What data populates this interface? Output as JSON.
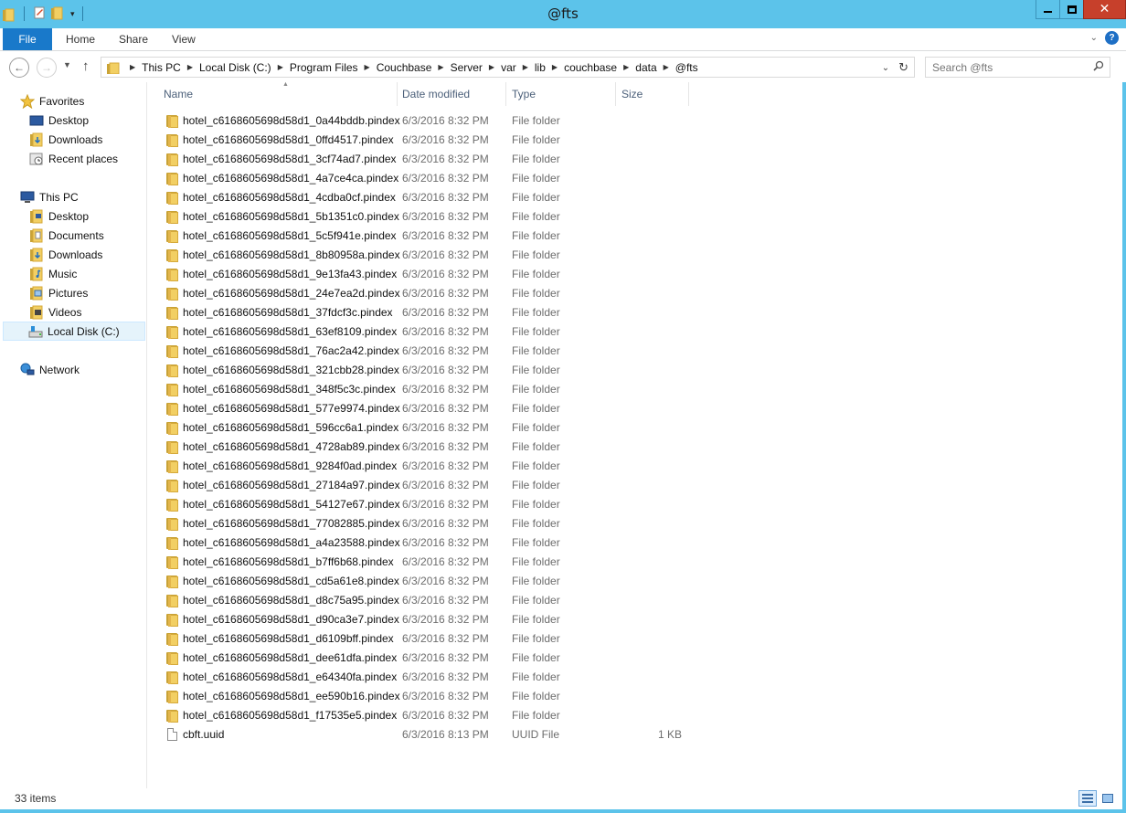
{
  "window": {
    "title": "@fts"
  },
  "ribbon": {
    "tabs": [
      "File",
      "Home",
      "Share",
      "View"
    ]
  },
  "address": {
    "crumbs": [
      "This PC",
      "Local Disk (C:)",
      "Program Files",
      "Couchbase",
      "Server",
      "var",
      "lib",
      "couchbase",
      "data",
      "@fts"
    ]
  },
  "search": {
    "placeholder": "Search @fts"
  },
  "navpane": {
    "favorites_label": "Favorites",
    "favorites": [
      "Desktop",
      "Downloads",
      "Recent places"
    ],
    "thispc_label": "This PC",
    "thispc": [
      "Desktop",
      "Documents",
      "Downloads",
      "Music",
      "Pictures",
      "Videos",
      "Local Disk (C:)"
    ],
    "network_label": "Network"
  },
  "columns": {
    "name": "Name",
    "date": "Date modified",
    "type": "Type",
    "size": "Size"
  },
  "files": [
    {
      "name": "hotel_c6168605698d58d1_0a44bddb.pindex",
      "date": "6/3/2016 8:32 PM",
      "type": "File folder",
      "size": "",
      "kind": "folder"
    },
    {
      "name": "hotel_c6168605698d58d1_0ffd4517.pindex",
      "date": "6/3/2016 8:32 PM",
      "type": "File folder",
      "size": "",
      "kind": "folder"
    },
    {
      "name": "hotel_c6168605698d58d1_3cf74ad7.pindex",
      "date": "6/3/2016 8:32 PM",
      "type": "File folder",
      "size": "",
      "kind": "folder"
    },
    {
      "name": "hotel_c6168605698d58d1_4a7ce4ca.pindex",
      "date": "6/3/2016 8:32 PM",
      "type": "File folder",
      "size": "",
      "kind": "folder"
    },
    {
      "name": "hotel_c6168605698d58d1_4cdba0cf.pindex",
      "date": "6/3/2016 8:32 PM",
      "type": "File folder",
      "size": "",
      "kind": "folder"
    },
    {
      "name": "hotel_c6168605698d58d1_5b1351c0.pindex",
      "date": "6/3/2016 8:32 PM",
      "type": "File folder",
      "size": "",
      "kind": "folder"
    },
    {
      "name": "hotel_c6168605698d58d1_5c5f941e.pindex",
      "date": "6/3/2016 8:32 PM",
      "type": "File folder",
      "size": "",
      "kind": "folder"
    },
    {
      "name": "hotel_c6168605698d58d1_8b80958a.pindex",
      "date": "6/3/2016 8:32 PM",
      "type": "File folder",
      "size": "",
      "kind": "folder"
    },
    {
      "name": "hotel_c6168605698d58d1_9e13fa43.pindex",
      "date": "6/3/2016 8:32 PM",
      "type": "File folder",
      "size": "",
      "kind": "folder"
    },
    {
      "name": "hotel_c6168605698d58d1_24e7ea2d.pindex",
      "date": "6/3/2016 8:32 PM",
      "type": "File folder",
      "size": "",
      "kind": "folder"
    },
    {
      "name": "hotel_c6168605698d58d1_37fdcf3c.pindex",
      "date": "6/3/2016 8:32 PM",
      "type": "File folder",
      "size": "",
      "kind": "folder"
    },
    {
      "name": "hotel_c6168605698d58d1_63ef8109.pindex",
      "date": "6/3/2016 8:32 PM",
      "type": "File folder",
      "size": "",
      "kind": "folder"
    },
    {
      "name": "hotel_c6168605698d58d1_76ac2a42.pindex",
      "date": "6/3/2016 8:32 PM",
      "type": "File folder",
      "size": "",
      "kind": "folder"
    },
    {
      "name": "hotel_c6168605698d58d1_321cbb28.pindex",
      "date": "6/3/2016 8:32 PM",
      "type": "File folder",
      "size": "",
      "kind": "folder"
    },
    {
      "name": "hotel_c6168605698d58d1_348f5c3c.pindex",
      "date": "6/3/2016 8:32 PM",
      "type": "File folder",
      "size": "",
      "kind": "folder"
    },
    {
      "name": "hotel_c6168605698d58d1_577e9974.pindex",
      "date": "6/3/2016 8:32 PM",
      "type": "File folder",
      "size": "",
      "kind": "folder"
    },
    {
      "name": "hotel_c6168605698d58d1_596cc6a1.pindex",
      "date": "6/3/2016 8:32 PM",
      "type": "File folder",
      "size": "",
      "kind": "folder"
    },
    {
      "name": "hotel_c6168605698d58d1_4728ab89.pindex",
      "date": "6/3/2016 8:32 PM",
      "type": "File folder",
      "size": "",
      "kind": "folder"
    },
    {
      "name": "hotel_c6168605698d58d1_9284f0ad.pindex",
      "date": "6/3/2016 8:32 PM",
      "type": "File folder",
      "size": "",
      "kind": "folder"
    },
    {
      "name": "hotel_c6168605698d58d1_27184a97.pindex",
      "date": "6/3/2016 8:32 PM",
      "type": "File folder",
      "size": "",
      "kind": "folder"
    },
    {
      "name": "hotel_c6168605698d58d1_54127e67.pindex",
      "date": "6/3/2016 8:32 PM",
      "type": "File folder",
      "size": "",
      "kind": "folder"
    },
    {
      "name": "hotel_c6168605698d58d1_77082885.pindex",
      "date": "6/3/2016 8:32 PM",
      "type": "File folder",
      "size": "",
      "kind": "folder"
    },
    {
      "name": "hotel_c6168605698d58d1_a4a23588.pindex",
      "date": "6/3/2016 8:32 PM",
      "type": "File folder",
      "size": "",
      "kind": "folder"
    },
    {
      "name": "hotel_c6168605698d58d1_b7ff6b68.pindex",
      "date": "6/3/2016 8:32 PM",
      "type": "File folder",
      "size": "",
      "kind": "folder"
    },
    {
      "name": "hotel_c6168605698d58d1_cd5a61e8.pindex",
      "date": "6/3/2016 8:32 PM",
      "type": "File folder",
      "size": "",
      "kind": "folder"
    },
    {
      "name": "hotel_c6168605698d58d1_d8c75a95.pindex",
      "date": "6/3/2016 8:32 PM",
      "type": "File folder",
      "size": "",
      "kind": "folder"
    },
    {
      "name": "hotel_c6168605698d58d1_d90ca3e7.pindex",
      "date": "6/3/2016 8:32 PM",
      "type": "File folder",
      "size": "",
      "kind": "folder"
    },
    {
      "name": "hotel_c6168605698d58d1_d6109bff.pindex",
      "date": "6/3/2016 8:32 PM",
      "type": "File folder",
      "size": "",
      "kind": "folder"
    },
    {
      "name": "hotel_c6168605698d58d1_dee61dfa.pindex",
      "date": "6/3/2016 8:32 PM",
      "type": "File folder",
      "size": "",
      "kind": "folder"
    },
    {
      "name": "hotel_c6168605698d58d1_e64340fa.pindex",
      "date": "6/3/2016 8:32 PM",
      "type": "File folder",
      "size": "",
      "kind": "folder"
    },
    {
      "name": "hotel_c6168605698d58d1_ee590b16.pindex",
      "date": "6/3/2016 8:32 PM",
      "type": "File folder",
      "size": "",
      "kind": "folder"
    },
    {
      "name": "hotel_c6168605698d58d1_f17535e5.pindex",
      "date": "6/3/2016 8:32 PM",
      "type": "File folder",
      "size": "",
      "kind": "folder"
    },
    {
      "name": "cbft.uuid",
      "date": "6/3/2016 8:13 PM",
      "type": "UUID File",
      "size": "1 KB",
      "kind": "file"
    }
  ],
  "status": {
    "count": "33 items"
  },
  "colors": {
    "frame": "#5cc3ea",
    "file_tab": "#1979ca",
    "close": "#c7402b",
    "header_text": "#4c607a"
  }
}
